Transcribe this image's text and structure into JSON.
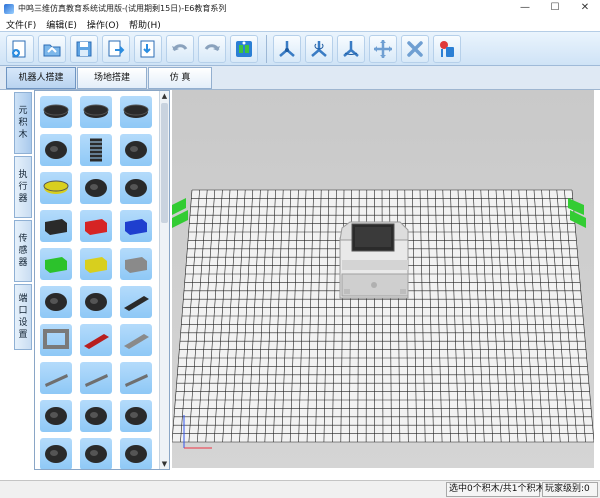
{
  "window": {
    "title": "中鸣三维仿真教育系统试用版-(试用期剩15日)-E6教育系列",
    "minimize_glyph": "—",
    "maximize_glyph": "☐",
    "close_glyph": "✕"
  },
  "menu": {
    "items": [
      "文件(F)",
      "编辑(E)",
      "操作(O)",
      "帮助(H)"
    ]
  },
  "toolbar": {
    "icons": [
      "new-icon",
      "open-icon",
      "save-icon",
      "export-icon",
      "import-icon",
      "undo-icon",
      "redo-icon",
      "robot-kit-icon",
      "rotate-x-icon",
      "rotate-y-icon",
      "rotate-z-icon",
      "move-icon",
      "delete-icon",
      "run-icon"
    ]
  },
  "tabs": [
    {
      "label": "机器人搭建",
      "active": true
    },
    {
      "label": "场地搭建",
      "active": false
    },
    {
      "label": "仿  真",
      "active": false
    }
  ],
  "side_tabs": [
    {
      "label": "元积木",
      "active": true
    },
    {
      "label": "执行器",
      "active": false
    },
    {
      "label": "传感器",
      "active": false
    },
    {
      "label": "端口设置",
      "active": false
    }
  ],
  "palette": {
    "scroll_up": "▲",
    "scroll_down": "▼",
    "items": [
      "gear-part",
      "gear-part",
      "gear-part",
      "wheel-part",
      "spring-part",
      "connector-part",
      "yellow-gear-part",
      "tire-part",
      "axle-part",
      "black-block-part",
      "red-block-part",
      "blue-block-part",
      "green-block-part",
      "yellow-block-part",
      "gray-block-part",
      "bracket-part",
      "hub-part",
      "beam-part",
      "frame-part",
      "red-beam-part",
      "gray-beam-part",
      "rod-part",
      "rod-part",
      "rod-part",
      "motor-part",
      "motor-part",
      "motor-part",
      "clip-part",
      "wheel-part",
      "connector-part"
    ]
  },
  "viewport": {
    "background": "#cccccc",
    "grid_color": "#222222",
    "floor_color": "#f2f2f2",
    "controller_name": "E6 controller"
  },
  "status": {
    "selected": "选中0个积木/共1个积木",
    "level": "玩家级别:0"
  },
  "colors": {
    "toolbar_bg": "#d7e8f7",
    "tile_bg": "#a3d2f8",
    "accent_green": "#33cc33"
  }
}
